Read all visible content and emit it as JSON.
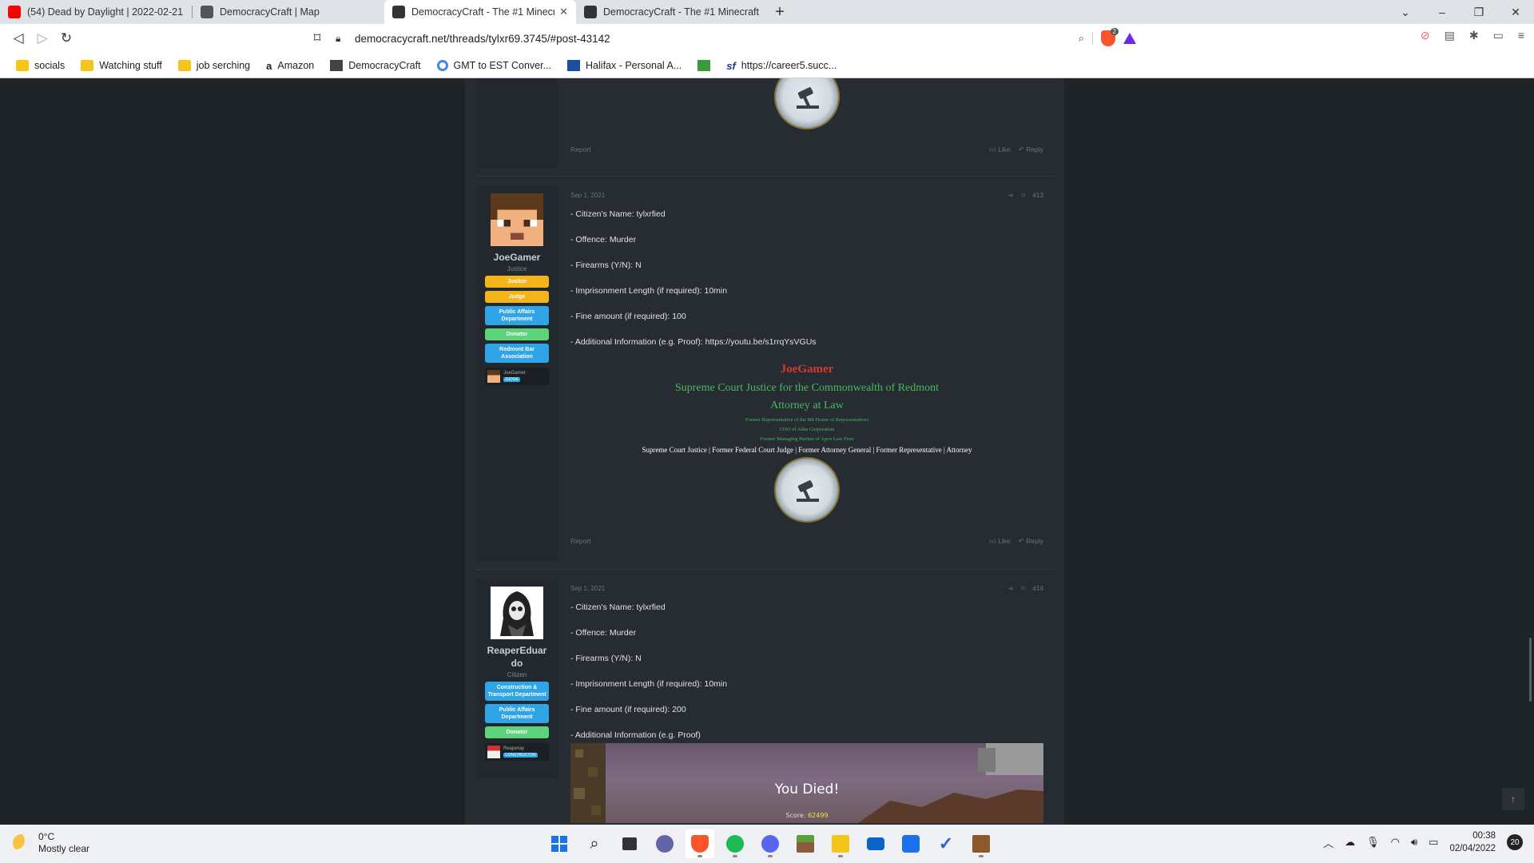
{
  "browser": {
    "tabs": [
      {
        "label": "(54) Dead by Daylight | 2022-02-21 - Y",
        "icon": "youtube-icon",
        "color": "#ff0000",
        "active": false
      },
      {
        "label": "DemocracyCraft | Map",
        "icon": "cube-icon",
        "color": "#555555",
        "active": false
      },
      {
        "label": "DemocracyCraft - The #1 Minecra",
        "icon": "democracycraft-icon",
        "color": "#333333",
        "active": true
      },
      {
        "label": "DemocracyCraft - The #1 Minecraft Ci",
        "icon": "democracycraft-icon",
        "color": "#333333",
        "active": false
      }
    ],
    "new_tab": "+",
    "url": "democracycraft.net/threads/tylxr69.3745/#post-43142",
    "shield_count": "2",
    "bookmarks": [
      {
        "label": "socials",
        "icon": "folder-icon"
      },
      {
        "label": "Watching stuff",
        "icon": "folder-icon"
      },
      {
        "label": "job serching",
        "icon": "folder-icon"
      },
      {
        "label": "Amazon",
        "icon": "amazon-icon"
      },
      {
        "label": "DemocracyCraft",
        "icon": "democracycraft-icon"
      },
      {
        "label": "GMT to EST Conver...",
        "icon": "google-icon"
      },
      {
        "label": "Halifax - Personal A...",
        "icon": "halifax-icon"
      },
      {
        "label": "",
        "icon": "green-square-icon"
      },
      {
        "label": "https://career5.succ...",
        "icon": "sf-icon"
      }
    ]
  },
  "prev_post": {
    "report": "Report",
    "like": "Like",
    "reply": "Reply"
  },
  "post13": {
    "user": {
      "name": "JoeGamer",
      "title": "Justice",
      "banners": [
        {
          "text": "Justice",
          "color": "gold"
        },
        {
          "text": "Judge",
          "color": "gold"
        },
        {
          "text": "Public Affairs Department",
          "color": "blue"
        },
        {
          "text": "Donator",
          "color": "green"
        },
        {
          "text": "Redmont Bar Association",
          "color": "blue"
        }
      ],
      "mini_name": "JoeGamer",
      "mini_badge": "JUDGE"
    },
    "date": "Sep 1, 2021",
    "number": "#13",
    "lines": [
      "- Citizen's Name: tylxrfied",
      "- Offence: Murder",
      "- Firearms (Y/N): N",
      "- Imprisonment Length (if required): 10min",
      "- Fine amount (if required): 100",
      "- Additional Information (e.g. Proof): https://youtu.be/s1rrqYsVGUs"
    ],
    "signature": {
      "name": "JoeGamer",
      "role1": "Supreme Court Justice for the Commonwealth of Redmont",
      "role2": "Attorney at Law",
      "small1": "Former Representative of the 8th House of Representatives",
      "small2": "COO of Atlas Corporation",
      "small3": "Former Managing Partner of Apex Law Firm",
      "white": "Supreme Court Justice | Former Federal Court Judge | Former Attorney General | Former Representative | Attorney"
    },
    "report": "Report",
    "like": "Like",
    "reply": "Reply"
  },
  "post14": {
    "user": {
      "name": "ReaperEduardo",
      "name_line1": "ReaperEduar",
      "name_line2": "do",
      "title": "Citizen",
      "banners": [
        {
          "text": "Construction & Transport Department",
          "color": "blue"
        },
        {
          "text": "Public Affairs Department",
          "color": "blue"
        },
        {
          "text": "Donator",
          "color": "green"
        }
      ],
      "mini_name": "Reaperay",
      "mini_badge": "CONSTRUCTOR"
    },
    "date": "Sep 1, 2021",
    "number": "#14",
    "lines": [
      "- Citizen's Name: tylxrfied",
      "- Offence: Murder",
      "- Firearms (Y/N): N",
      "- Imprisonment Length (if required): 10min",
      "- Fine amount (if required): 200",
      "- Additional Information (e.g. Proof)"
    ],
    "screenshot": {
      "title": "You Died!",
      "score_label": "Score:",
      "score_value": "62499"
    }
  },
  "taskbar": {
    "weather_temp": "0°C",
    "weather_desc": "Mostly clear",
    "time": "00:38",
    "date": "02/04/2022",
    "notifications": "20",
    "apps": [
      "windows-start-icon",
      "search-icon",
      "task-view-icon",
      "chat-icon",
      "brave-icon",
      "spotify-icon",
      "discord-icon",
      "minecraft-icon",
      "file-explorer-icon",
      "mail-icon",
      "calendar-icon",
      "todo-icon",
      "minecraft-launcher-icon"
    ]
  },
  "colors": {
    "page_bg": "#1e2428",
    "post_bg": "#262c31",
    "gold": "#f4b41a",
    "blue": "#2fa4e7",
    "green": "#5dd37a",
    "sig_red": "#d63a2f",
    "sig_green": "#49b85f"
  }
}
